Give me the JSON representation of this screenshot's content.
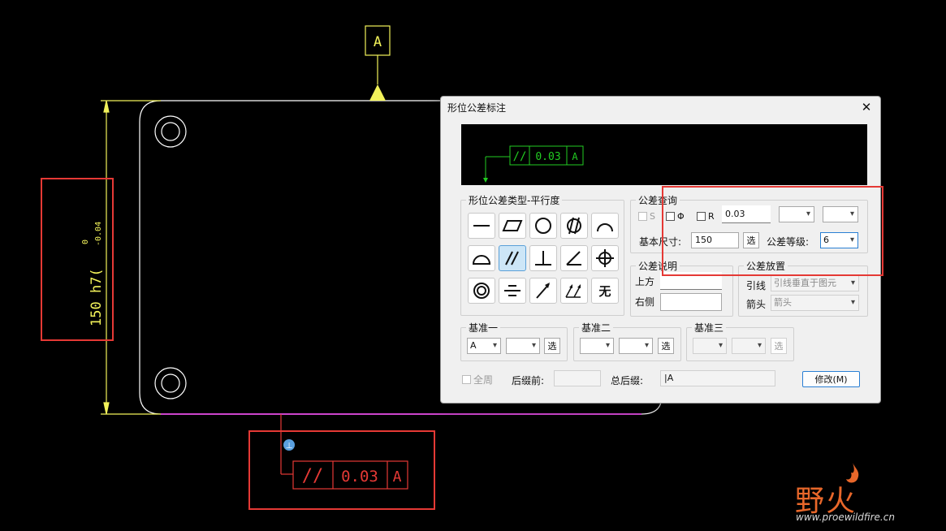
{
  "canvas": {
    "datum_label": "A",
    "dimension_text": "150 h7(",
    "tol_upper": "0",
    "tol_lower": "-0.04",
    "fcf": {
      "symbol": "//",
      "value": "0.03",
      "datum": "A"
    },
    "colors": {
      "background": "#000000",
      "part": "#ffffff",
      "dimension": "#f2f25a",
      "selected": "#cc44cc",
      "annotation": "#e53935",
      "preview": "#22cc22",
      "highlight": "#e53935"
    }
  },
  "dialog": {
    "title": "形位公差标注",
    "preview": {
      "symbol": "//",
      "value": "0.03",
      "datum": "A"
    },
    "type_group": {
      "legend": "形位公差类型-平行度",
      "symbols": [
        "straightness",
        "flatness",
        "circularity",
        "cylindricity",
        "line-profile",
        "surface-profile",
        "parallelism",
        "perpendicularity",
        "angularity",
        "position",
        "concentricity",
        "symmetry",
        "circular-runout",
        "total-runout",
        "none"
      ],
      "selected": "parallelism",
      "none_label": "无"
    },
    "query_group": {
      "legend": "公差查询",
      "chk_s": "S",
      "chk_phi": "Φ",
      "chk_r": "R",
      "tol_value": "0.03",
      "basic_size_label": "基本尺寸:",
      "basic_size": "150",
      "select_label": "选",
      "grade_label": "公差等级:",
      "grade": "6"
    },
    "note_group": {
      "legend": "公差说明",
      "upper_label": "上方",
      "right_label": "右侧",
      "upper_value": "",
      "right_value": ""
    },
    "placement_group": {
      "legend": "公差放置",
      "leader_label": "引线",
      "leader_value": "引线垂直于图元",
      "arrow_label": "箭头",
      "arrow_value": "箭头"
    },
    "datum1": {
      "legend": "基准一",
      "value": "A",
      "select_label": "选"
    },
    "datum2": {
      "legend": "基准二",
      "value": "",
      "select_label": "选"
    },
    "datum3": {
      "legend": "基准三",
      "value": "",
      "select_label": "选"
    },
    "all_around_label": "全周",
    "prefix_label": "后缀前:",
    "prefix_value": "",
    "suffix_label": "总后缀:",
    "suffix_value": "|A",
    "modify_button": "修改(M)"
  },
  "watermark": {
    "brand": "野火",
    "url": "www.proewildfire.cn"
  }
}
